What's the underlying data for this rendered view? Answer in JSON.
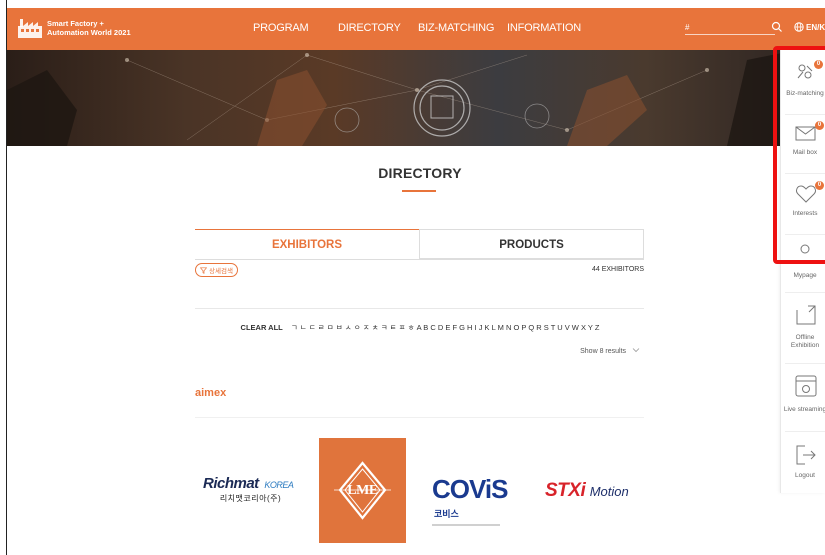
{
  "header": {
    "logo_line1": "Smart Factory +",
    "logo_line2": "Automation World 2021",
    "nav": [
      "PROGRAM",
      "DIRECTORY",
      "BIZ-MATCHING",
      "INFORMATION"
    ],
    "search_value": "#",
    "lang": "EN/KO"
  },
  "page": {
    "title": "DIRECTORY"
  },
  "tabs": {
    "exhibitors": "EXHIBITORS",
    "products": "PRODUCTS"
  },
  "filter": {
    "detail_label": "상세검색",
    "count": "44 EXHIBITORS",
    "clear_all": "CLEAR ALL",
    "alphabet": "ㄱ ㄴ ㄷ ㄹ ㅁ ㅂ ㅅ ㅇ ㅈ ㅊ ㅋ ㅌ ㅍ ㅎ A B C D E F G H I J K L M N O P Q R S T U V W X Y Z",
    "show_results": "Show 8 results"
  },
  "section": {
    "name": "aimex"
  },
  "brands": {
    "richmat_main": "Richmat",
    "richmat_sub": "KOREA",
    "richmat_kr": "리치맷코리아(주)",
    "lme": "LME",
    "covis": "COViS",
    "covis_kr": "코비스",
    "stxi": "STXi",
    "stxi_motion": "Motion"
  },
  "sidebar": {
    "items": [
      {
        "label": "Biz-matching",
        "badge": "0",
        "icon": "handshake-icon"
      },
      {
        "label": "Mail box",
        "badge": "0",
        "icon": "mail-icon"
      },
      {
        "label": "Interests",
        "badge": "0",
        "icon": "heart-icon"
      },
      {
        "label": "Mypage",
        "icon": "user-icon"
      },
      {
        "label": "Offline Exhibition",
        "icon": "external-link-icon"
      },
      {
        "label": "Live streaming",
        "icon": "live-icon"
      },
      {
        "label": "Logout",
        "icon": "logout-icon"
      }
    ]
  },
  "colors": {
    "accent": "#e8743b",
    "highlight": "#ee1111"
  }
}
